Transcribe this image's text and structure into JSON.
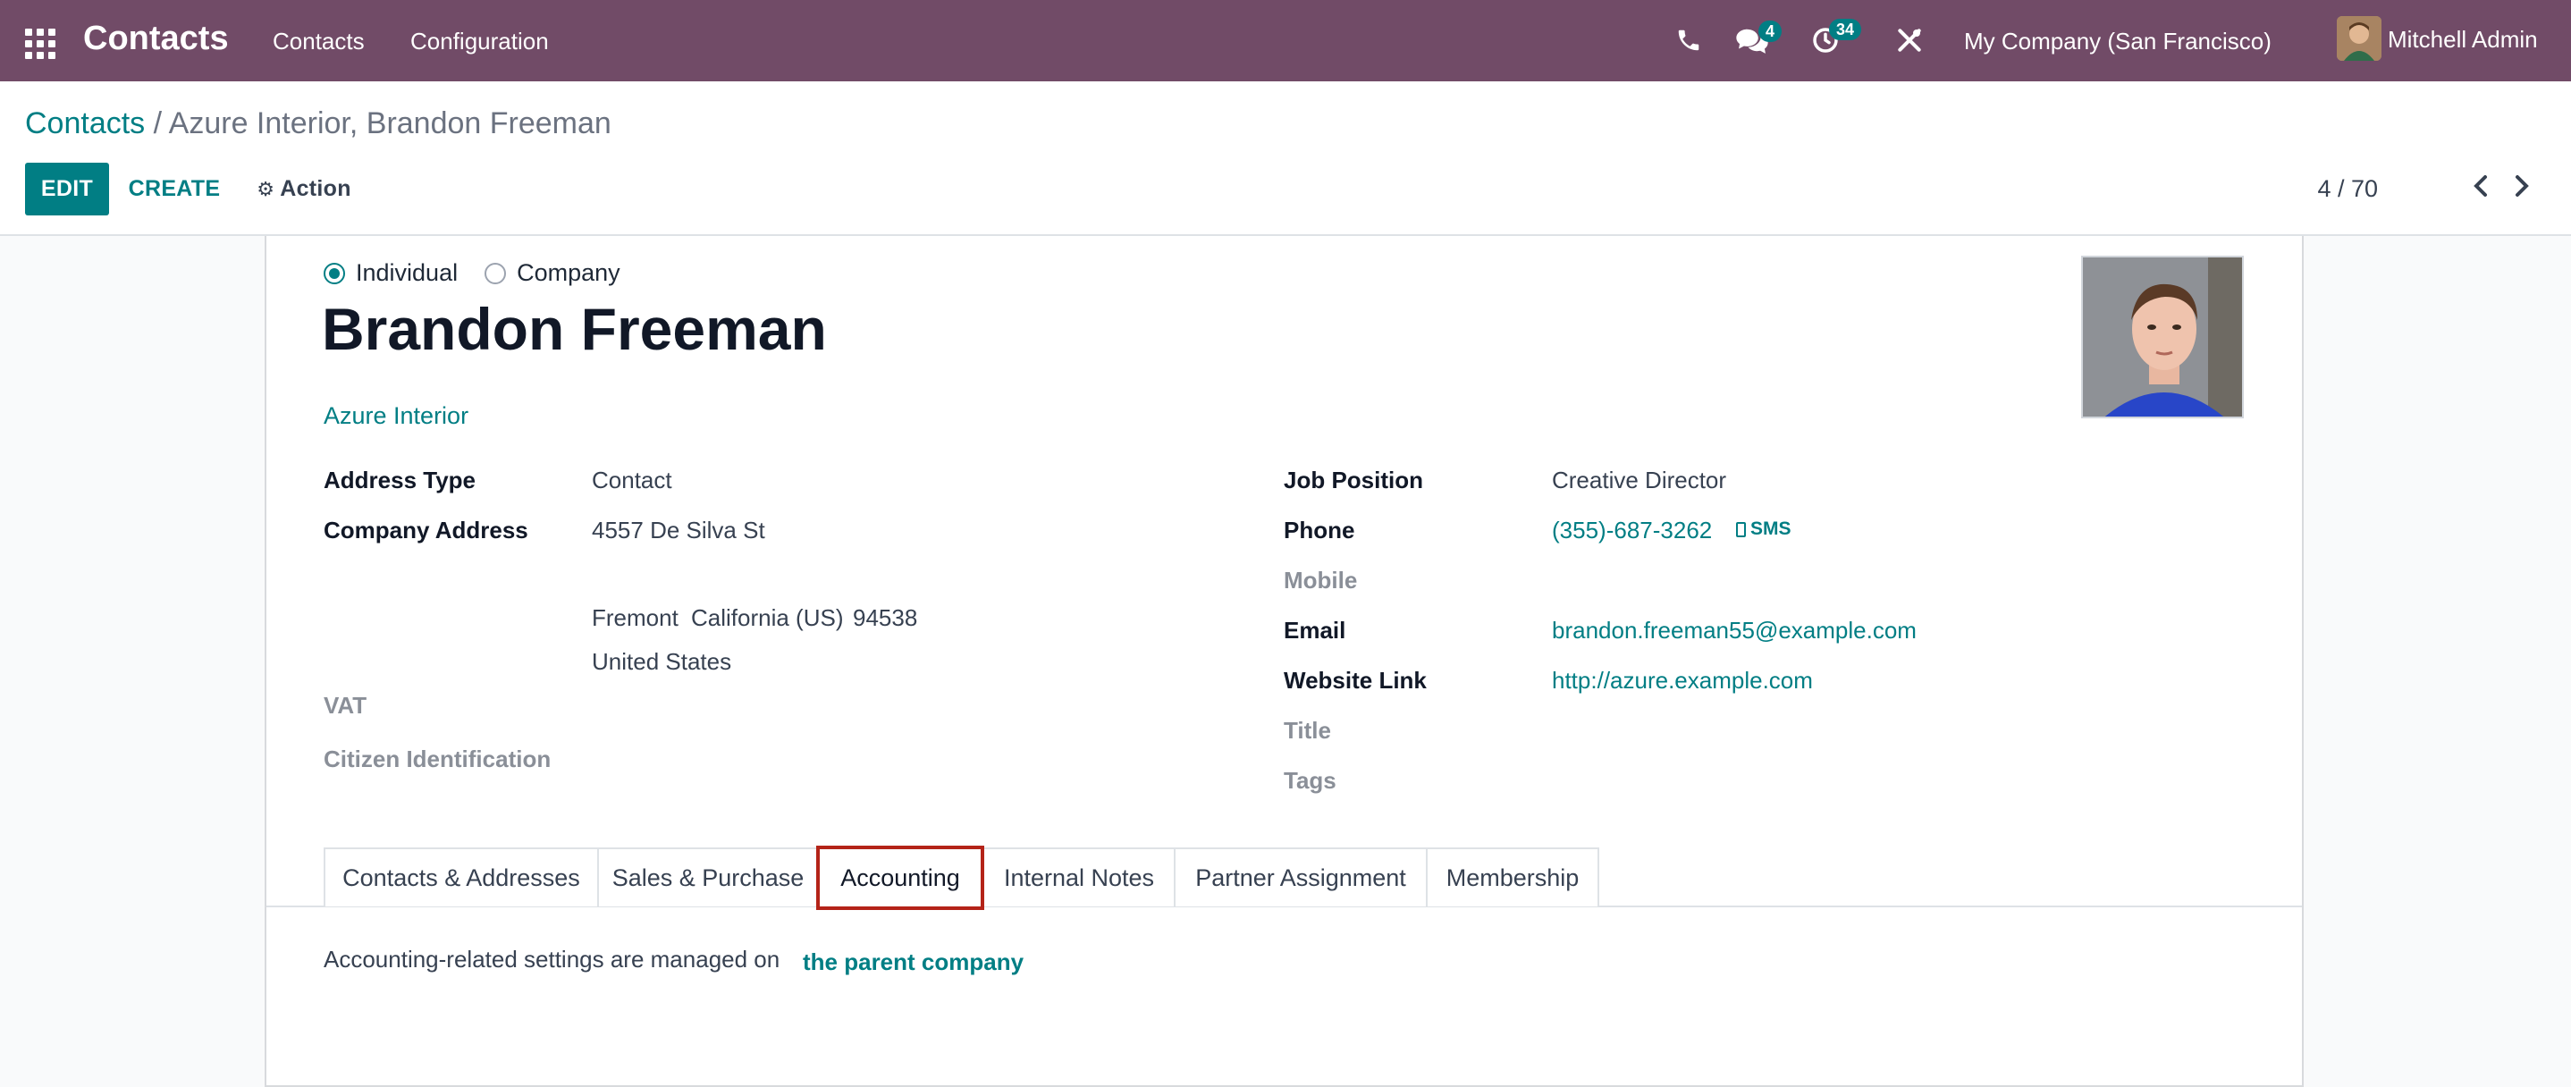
{
  "navbar": {
    "app_title": "Contacts",
    "menu": [
      "Contacts",
      "Configuration"
    ],
    "messages_count": "4",
    "activities_count": "34",
    "company": "My Company (San Francisco)",
    "user": "Mitchell Admin",
    "icons": [
      "apps-icon",
      "phone-icon",
      "chat-icon",
      "clock-icon",
      "tools-icon",
      "avatar"
    ],
    "colors": {
      "navbar": "#714b67",
      "accent": "#017e84"
    }
  },
  "control_panel": {
    "breadcrumb_root": "Contacts",
    "breadcrumb_separator": "/",
    "breadcrumb_current": "Azure Interior, Brandon Freeman",
    "edit_label": "EDIT",
    "create_label": "CREATE",
    "action_label": "Action",
    "pager": "4 / 70"
  },
  "form": {
    "type_options": [
      "Individual",
      "Company"
    ],
    "selected_type": "Individual",
    "name": "Brandon Freeman",
    "parent_company": "Azure Interior",
    "left_fields": {
      "address_type_label": "Address Type",
      "address_type_value": "Contact",
      "company_address_label": "Company Address",
      "street": "4557 De Silva St",
      "city": "Fremont",
      "state": "California (US)",
      "zip": "94538",
      "country": "United States",
      "vat_label": "VAT",
      "citizen_id_label": "Citizen Identification"
    },
    "right_fields": {
      "job_position_label": "Job Position",
      "job_position_value": "Creative Director",
      "phone_label": "Phone",
      "phone_value": "(355)-687-3262",
      "sms_label": "SMS",
      "mobile_label": "Mobile",
      "email_label": "Email",
      "email_value": "brandon.freeman55@example.com",
      "website_label": "Website Link",
      "website_value": "http://azure.example.com",
      "title_label": "Title",
      "tags_label": "Tags"
    },
    "tabs": [
      "Contacts & Addresses",
      "Sales & Purchase",
      "Accounting",
      "Internal Notes",
      "Partner Assignment",
      "Membership"
    ],
    "active_tab": "Accounting",
    "accounting_text": "Accounting-related settings are managed on",
    "accounting_link": "the parent company"
  }
}
